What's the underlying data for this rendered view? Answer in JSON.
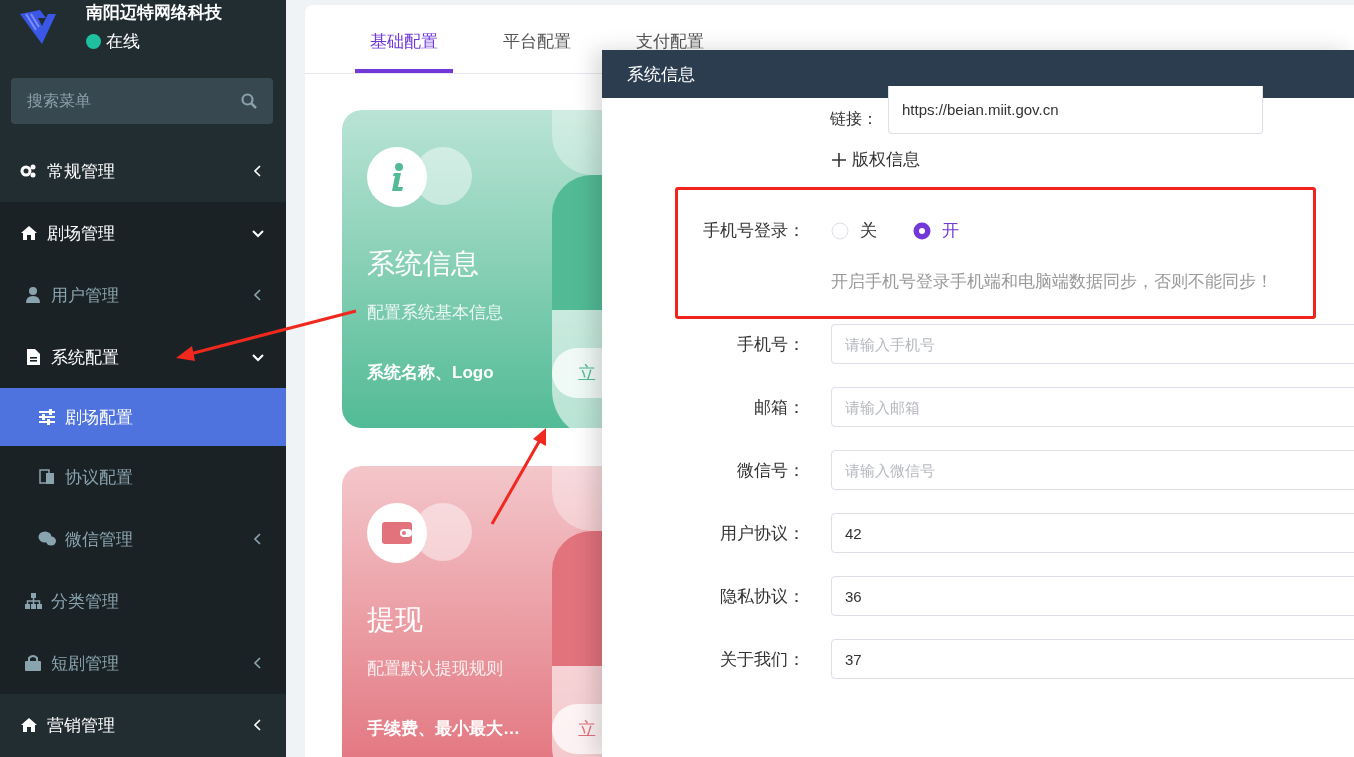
{
  "sidebar": {
    "brand": "南阳迈特网络科技",
    "status": "在线",
    "search": {
      "placeholder": "搜索菜单"
    },
    "menu": [
      {
        "label": "常规管理",
        "expanded": false,
        "selected": false
      },
      {
        "label": "剧场管理",
        "expanded": true,
        "selected": false,
        "children": [
          {
            "label": "用户管理",
            "expanded": false,
            "selected": false
          },
          {
            "label": "系统配置",
            "expanded": true,
            "selected": false,
            "children": [
              {
                "label": "剧场配置",
                "selected": true
              },
              {
                "label": "协议配置",
                "selected": false
              },
              {
                "label": "微信管理",
                "expanded": false,
                "selected": false
              }
            ]
          },
          {
            "label": "分类管理",
            "selected": false
          },
          {
            "label": "短剧管理",
            "expanded": false,
            "selected": false
          }
        ]
      },
      {
        "label": "营销管理",
        "expanded": false,
        "selected": false
      }
    ]
  },
  "tabs": [
    {
      "label": "基础配置",
      "selected": true
    },
    {
      "label": "平台配置",
      "selected": false
    },
    {
      "label": "支付配置",
      "selected": false
    }
  ],
  "cards": [
    {
      "title": "系统信息",
      "subtitle": "配置系统基本信息",
      "detail": "系统名称、Logo",
      "button": "立",
      "color": "#52bb96"
    },
    {
      "title": "提现",
      "subtitle": "配置默认提现规则",
      "detail": "手续费、最小最大…",
      "button": "立",
      "color": "#e2727c"
    }
  ],
  "drawer": {
    "title": "系统信息",
    "link": {
      "label": "链接：",
      "value": "https://beian.miit.gov.cn"
    },
    "add_copyright": "版权信息",
    "phone_login": {
      "label": "手机号登录：",
      "options": [
        {
          "label": "关",
          "selected": false
        },
        {
          "label": "开",
          "selected": true
        }
      ],
      "hint": "开启手机号登录手机端和电脑端数据同步，否则不能同步！"
    },
    "fields": [
      {
        "label": "手机号：",
        "placeholder": "请输入手机号"
      },
      {
        "label": "邮箱：",
        "placeholder": "请输入邮箱"
      },
      {
        "label": "微信号：",
        "placeholder": "请输入微信号"
      },
      {
        "label": "用户协议：",
        "value": "42"
      },
      {
        "label": "隐私协议：",
        "value": "36"
      },
      {
        "label": "关于我们：",
        "value": "37"
      }
    ]
  }
}
